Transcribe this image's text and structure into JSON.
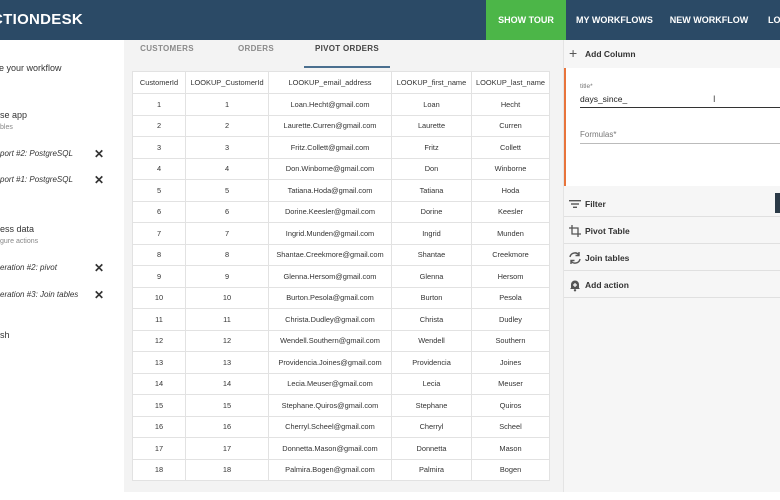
{
  "header": {
    "brand": "CTIONDESK",
    "nav": {
      "show_tour": "SHOW TOUR",
      "my_workflows": "MY WORKFLOWS",
      "new_workflow": "NEW WORKFLOW",
      "logout_partial": "LO"
    },
    "colors": {
      "bar": "#2b4a66",
      "tour": "#4cb648"
    }
  },
  "sidebar": {
    "heading": "e your workflow",
    "section1": {
      "title": "se app",
      "subtitle": "bles"
    },
    "items1": [
      "port #2: PostgreSQL",
      "port #1: PostgreSQL"
    ],
    "section2": {
      "title": "ess data",
      "subtitle": "gure actions"
    },
    "items2": [
      "eration #2: pivot",
      "eration #3: Join tables"
    ],
    "section3": {
      "title": "sh"
    }
  },
  "tabs": {
    "customers": "CUSTOMERS",
    "orders": "ORDERS",
    "pivot_orders": "PIVOT ORDERS"
  },
  "table": {
    "columns": [
      "CustomerId",
      "LOOKUP_CustomerId",
      "LOOKUP_email_address",
      "LOOKUP_first_name",
      "LOOKUP_last_name"
    ],
    "rows": [
      [
        "1",
        "1",
        "Loan.Hecht@gmail.com",
        "Loan",
        "Hecht"
      ],
      [
        "2",
        "2",
        "Laurette.Curren@gmail.com",
        "Laurette",
        "Curren"
      ],
      [
        "3",
        "3",
        "Fritz.Collett@gmail.com",
        "Fritz",
        "Collett"
      ],
      [
        "4",
        "4",
        "Don.Winborne@gmail.com",
        "Don",
        "Winborne"
      ],
      [
        "5",
        "5",
        "Tatiana.Hoda@gmail.com",
        "Tatiana",
        "Hoda"
      ],
      [
        "6",
        "6",
        "Dorine.Keesler@gmail.com",
        "Dorine",
        "Keesler"
      ],
      [
        "7",
        "7",
        "Ingrid.Munden@gmail.com",
        "Ingrid",
        "Munden"
      ],
      [
        "8",
        "8",
        "Shantae.Creekmore@gmail.com",
        "Shantae",
        "Creekmore"
      ],
      [
        "9",
        "9",
        "Glenna.Hersom@gmail.com",
        "Glenna",
        "Hersom"
      ],
      [
        "10",
        "10",
        "Burton.Pesola@gmail.com",
        "Burton",
        "Pesola"
      ],
      [
        "11",
        "11",
        "Christa.Dudley@gmail.com",
        "Christa",
        "Dudley"
      ],
      [
        "12",
        "12",
        "Wendell.Southern@gmail.com",
        "Wendell",
        "Southern"
      ],
      [
        "13",
        "13",
        "Providencia.Joines@gmail.com",
        "Providencia",
        "Joines"
      ],
      [
        "14",
        "14",
        "Lecia.Meuser@gmail.com",
        "Lecia",
        "Meuser"
      ],
      [
        "15",
        "15",
        "Stephane.Quiros@gmail.com",
        "Stephane",
        "Quiros"
      ],
      [
        "16",
        "16",
        "Cherryl.Scheel@gmail.com",
        "Cherryl",
        "Scheel"
      ],
      [
        "17",
        "17",
        "Donnetta.Mason@gmail.com",
        "Donnetta",
        "Mason"
      ],
      [
        "18",
        "18",
        "Palmira.Bogen@gmail.com",
        "Palmira",
        "Bogen"
      ]
    ]
  },
  "right_panel": {
    "add_column": "Add Column",
    "title_label": "title*",
    "title_value": "days_since_",
    "formulas_placeholder": "Formulas*",
    "accent": "#e8743b",
    "actions": [
      {
        "label": "Filter",
        "icon": "filter-icon"
      },
      {
        "label": "Pivot Table",
        "icon": "pivot-table-icon"
      },
      {
        "label": "Join tables",
        "icon": "join-tables-icon"
      },
      {
        "label": "Add action",
        "icon": "bell-plus-icon"
      }
    ]
  }
}
